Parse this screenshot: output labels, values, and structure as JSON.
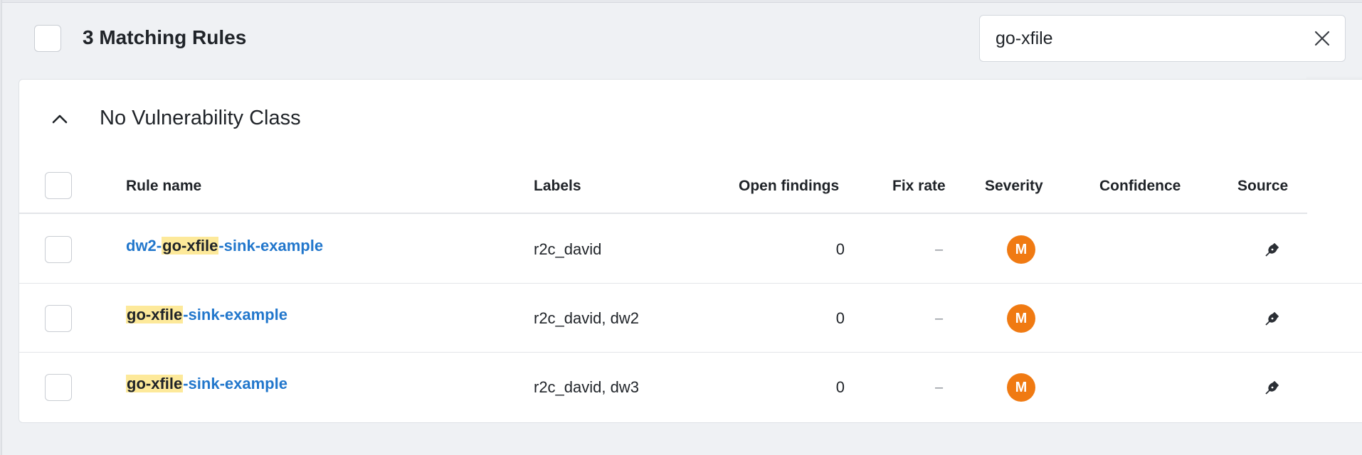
{
  "header": {
    "title": "3 Matching Rules"
  },
  "search": {
    "value": "go-xfile"
  },
  "group": {
    "title": "No Vulnerability Class"
  },
  "columns": {
    "rule_name": "Rule name",
    "labels": "Labels",
    "open_findings": "Open findings",
    "fix_rate": "Fix rate",
    "severity": "Severity",
    "confidence": "Confidence",
    "source": "Source"
  },
  "rows": [
    {
      "name_prefix": "dw2-",
      "name_match": "go-xfile",
      "name_suffix": "-sink-example",
      "labels": "r2c_david",
      "open_findings": "0",
      "fix_rate": "–",
      "severity": "M",
      "source_icon": "pen-nib-icon"
    },
    {
      "name_prefix": "",
      "name_match": "go-xfile",
      "name_suffix": "-sink-example",
      "labels": "r2c_david, dw2",
      "open_findings": "0",
      "fix_rate": "–",
      "severity": "M",
      "source_icon": "pen-nib-icon"
    },
    {
      "name_prefix": "",
      "name_match": "go-xfile",
      "name_suffix": "-sink-example",
      "labels": "r2c_david, dw3",
      "open_findings": "0",
      "fix_rate": "–",
      "severity": "M",
      "source_icon": "pen-nib-icon"
    }
  ],
  "colors": {
    "background": "#eff1f4",
    "link": "#2277cc",
    "highlight": "#fde99a",
    "severity_medium": "#f07a12"
  }
}
